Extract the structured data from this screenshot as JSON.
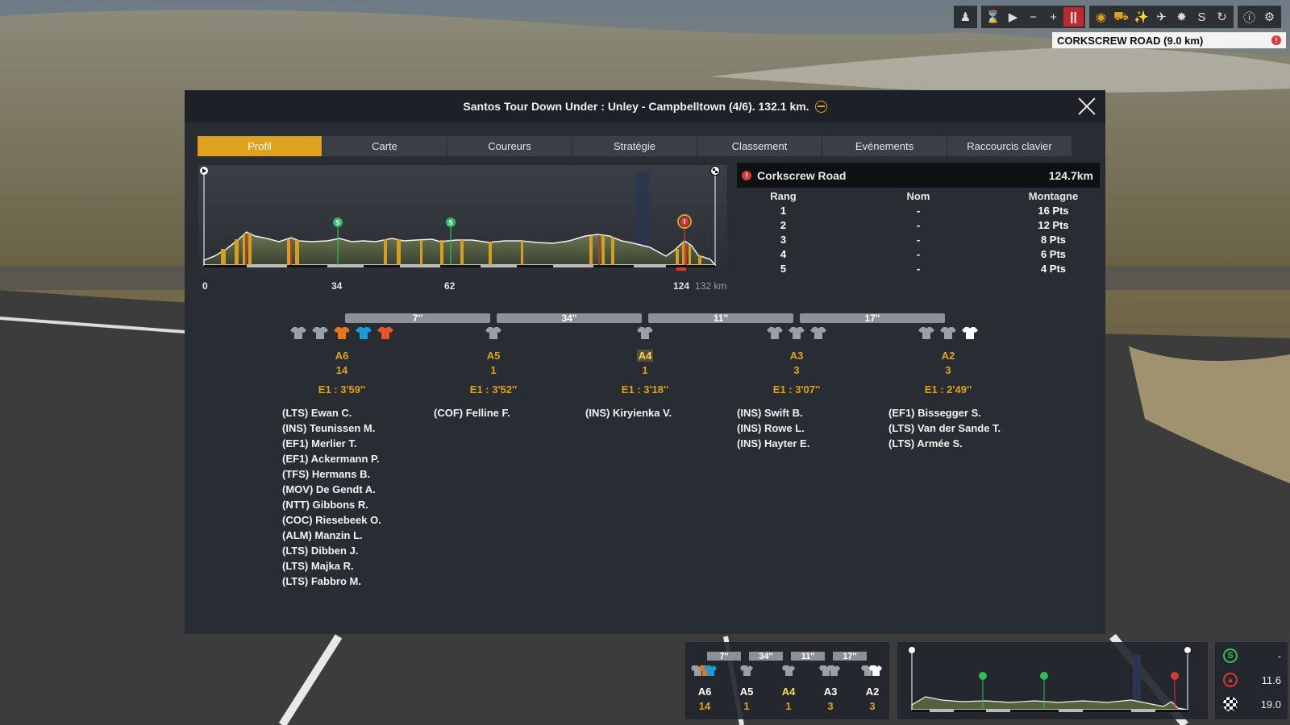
{
  "toolbar": {
    "icons": [
      "rider-icon",
      "hourglass-icon",
      "play-icon",
      "minus-icon",
      "plus-icon",
      "pause-icon",
      "eye-icon",
      "motorbike-icon",
      "helicopter-icon",
      "plane-icon",
      "wheel-icon",
      "sprint-icon",
      "refresh-icon",
      "info-icon",
      "gear-icon"
    ]
  },
  "stage_label": {
    "text": "CORKSCREW ROAD (9.0 km)"
  },
  "panel": {
    "title": "Santos Tour Down Under : Unley - Campbelltown (4/6). 132.1 km.",
    "tabs": [
      "Profil",
      "Carte",
      "Coureurs",
      "Stratégie",
      "Classement",
      "Evénements",
      "Raccourcis clavier"
    ],
    "active_tab": "Profil"
  },
  "profile": {
    "km_labels": [
      "0",
      "34",
      "62",
      "124",
      "132 km"
    ],
    "sprint_km": [
      34,
      62
    ],
    "climb_km": 124,
    "total_km": 132
  },
  "climb": {
    "name": "Corkscrew Road",
    "km": "124.7km",
    "headers": [
      "Rang",
      "Nom",
      "Montagne"
    ],
    "rows": [
      [
        "1",
        "-",
        "16 Pts"
      ],
      [
        "2",
        "-",
        "12 Pts"
      ],
      [
        "3",
        "-",
        "8 Pts"
      ],
      [
        "4",
        "-",
        "6 Pts"
      ],
      [
        "5",
        "-",
        "4 Pts"
      ]
    ]
  },
  "gaps": [
    "7''",
    "34''",
    "11''",
    "17''"
  ],
  "groups": [
    {
      "name": "A6",
      "count": "14",
      "time": "E1 : 3'59''",
      "jerseys": [
        "#9aa0a8",
        "#9aa0a8",
        "#e8751a",
        "#1a9ad6",
        "#e8572a"
      ],
      "riders": [
        "(LTS) Ewan C.",
        "(INS) Teunissen M.",
        "(EF1) Merlier T.",
        "(EF1) Ackermann P.",
        "(TFS) Hermans B.",
        "(MOV) De Gendt A.",
        "(NTT) Gibbons R.",
        "(COC) Riesebeek O.",
        "(ALM) Manzin L.",
        "(LTS) Dibben J.",
        "(LTS) Majka R.",
        "(LTS) Fabbro M."
      ]
    },
    {
      "name": "A5",
      "count": "1",
      "time": "E1 : 3'52''",
      "jerseys": [
        "#9aa0a8"
      ],
      "riders": [
        "(COF) Felline F."
      ]
    },
    {
      "name": "A4",
      "count": "1",
      "time": "E1 : 3'18''",
      "jerseys": [
        "#9aa0a8"
      ],
      "riders": [
        "(INS) Kiryienka V."
      ],
      "highlight": true
    },
    {
      "name": "A3",
      "count": "3",
      "time": "E1 : 3'07''",
      "jerseys": [
        "#9aa0a8",
        "#9aa0a8",
        "#9aa0a8"
      ],
      "riders": [
        "(INS) Swift B.",
        "(INS) Rowe L.",
        "(INS) Hayter E."
      ]
    },
    {
      "name": "A2",
      "count": "3",
      "time": "E1 : 2'49''",
      "jerseys": [
        "#9aa0a8",
        "#9aa0a8",
        "#ffffff"
      ],
      "riders": [
        "(EF1) Bissegger S.",
        "(LTS) Van der Sande T.",
        "(LTS) Armée S."
      ]
    }
  ],
  "mini": {
    "gaps": [
      "7''",
      "34''",
      "11''",
      "17''"
    ],
    "groups": [
      [
        "A6",
        "14"
      ],
      [
        "A5",
        "1"
      ],
      [
        "A4",
        "1"
      ],
      [
        "A3",
        "3"
      ],
      [
        "A2",
        "3"
      ]
    ]
  },
  "stats": [
    {
      "icon": "sprint-icon",
      "value": "-",
      "color": "#2fbf5a"
    },
    {
      "icon": "climb-icon",
      "value": "11.6",
      "color": "#d63a3a"
    },
    {
      "icon": "finish-flag-icon",
      "value": "19.0",
      "color": "#e8e8e8"
    }
  ],
  "colors": {
    "accent": "#e0a21d",
    "panel": "#282c33",
    "header": "#1d2026",
    "sprint": "#2fbf5a",
    "climb": "#d63a3a"
  }
}
